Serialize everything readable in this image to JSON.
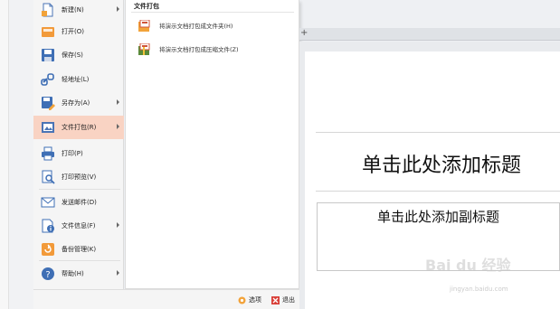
{
  "menu": {
    "items": [
      {
        "label": "新建(N)",
        "icon": "new-file-icon",
        "has_submenu": true
      },
      {
        "label": "打开(O)",
        "icon": "open-folder-icon",
        "has_submenu": false
      },
      {
        "label": "保存(S)",
        "icon": "save-icon",
        "has_submenu": false
      },
      {
        "label": "轻地址(L)",
        "icon": "link-icon",
        "has_submenu": false
      },
      {
        "label": "另存为(A)",
        "icon": "save-as-icon",
        "has_submenu": true
      },
      {
        "label": "文件打包(R)",
        "icon": "package-icon",
        "has_submenu": true,
        "active": true
      },
      {
        "label": "打印(P)",
        "icon": "print-icon",
        "has_submenu": false
      },
      {
        "label": "打印预览(V)",
        "icon": "print-preview-icon",
        "has_submenu": false
      },
      {
        "label": "发送邮件(D)",
        "icon": "mail-icon",
        "has_submenu": false
      },
      {
        "label": "文件信息(F)",
        "icon": "file-info-icon",
        "has_submenu": true
      },
      {
        "label": "备份管理(K)",
        "icon": "backup-icon",
        "has_submenu": false
      },
      {
        "label": "帮助(H)",
        "icon": "help-icon",
        "has_submenu": true
      }
    ]
  },
  "submenu": {
    "title": "文件打包",
    "items": [
      {
        "label": "将演示文档打包成文件夹(H)",
        "icon": "pack-folder-icon"
      },
      {
        "label": "将演示文档打包成压缩文件(Z)",
        "icon": "pack-zip-icon"
      }
    ]
  },
  "bottom_bar": {
    "options_label": "选项",
    "exit_label": "退出"
  },
  "tabbar": {
    "new_tab_symbol": "+"
  },
  "slide": {
    "title_placeholder": "单击此处添加标题",
    "subtitle_placeholder": "单击此处添加副标题"
  },
  "watermark": {
    "main": "Bai du 经验",
    "sub": "jingyan.baidu.com"
  },
  "colors": {
    "active_item_bg": "#f9d3c3",
    "menu_bg": "#f5f5f5"
  }
}
